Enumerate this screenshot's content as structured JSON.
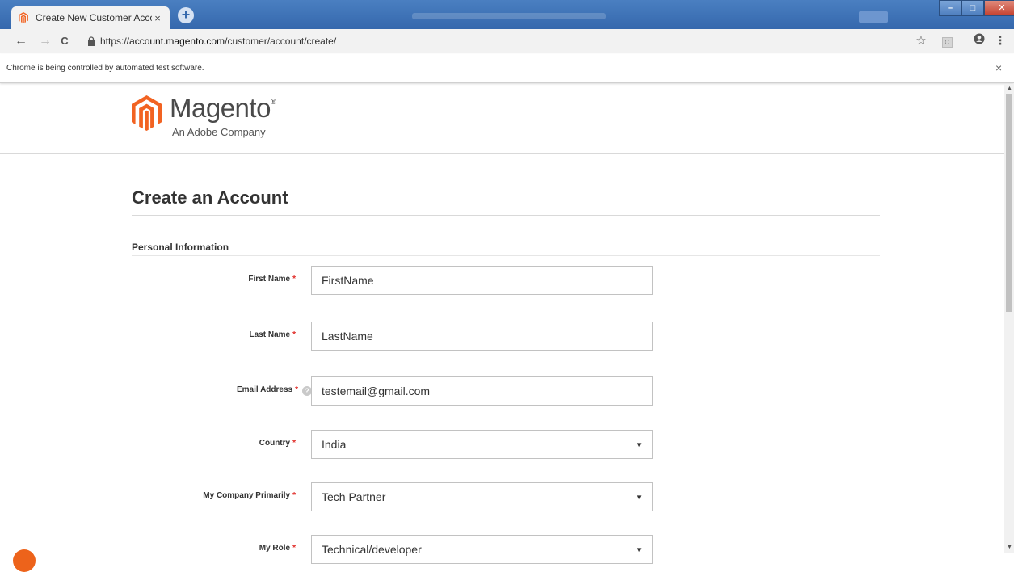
{
  "browser": {
    "tab_title": "Create New Customer Account",
    "tab_close": "×",
    "new_tab": "+",
    "url_scheme": "https://",
    "url_domain": "account.magento.com",
    "url_path": "/customer/account/create/",
    "infobar_message": "Chrome is being controlled by automated test software.",
    "infobar_close": "×",
    "icons": {
      "back": "←",
      "forward": "→",
      "reload": "C",
      "star": "☆",
      "menu": "⋮",
      "profile": "👤"
    }
  },
  "header": {
    "brand": "Magento",
    "trademark": "®",
    "tagline": "An Adobe Company",
    "brand_color": "#f26322"
  },
  "page": {
    "title": "Create an Account",
    "section": "Personal Information",
    "required_marker": "*",
    "fields": {
      "first_name": {
        "label": "First Name",
        "value": "FirstName"
      },
      "last_name": {
        "label": "Last Name",
        "value": "LastName"
      },
      "email": {
        "label": "Email Address",
        "value": "testemail@gmail.com",
        "help": "?"
      },
      "country": {
        "label": "Country",
        "value": "India"
      },
      "company": {
        "label": "My Company Primarily",
        "value": "Tech Partner"
      },
      "role": {
        "label": "My Role",
        "value": "Technical/developer"
      }
    }
  },
  "colors": {
    "required": "#e02b27",
    "titlebar": "#3568ad"
  }
}
